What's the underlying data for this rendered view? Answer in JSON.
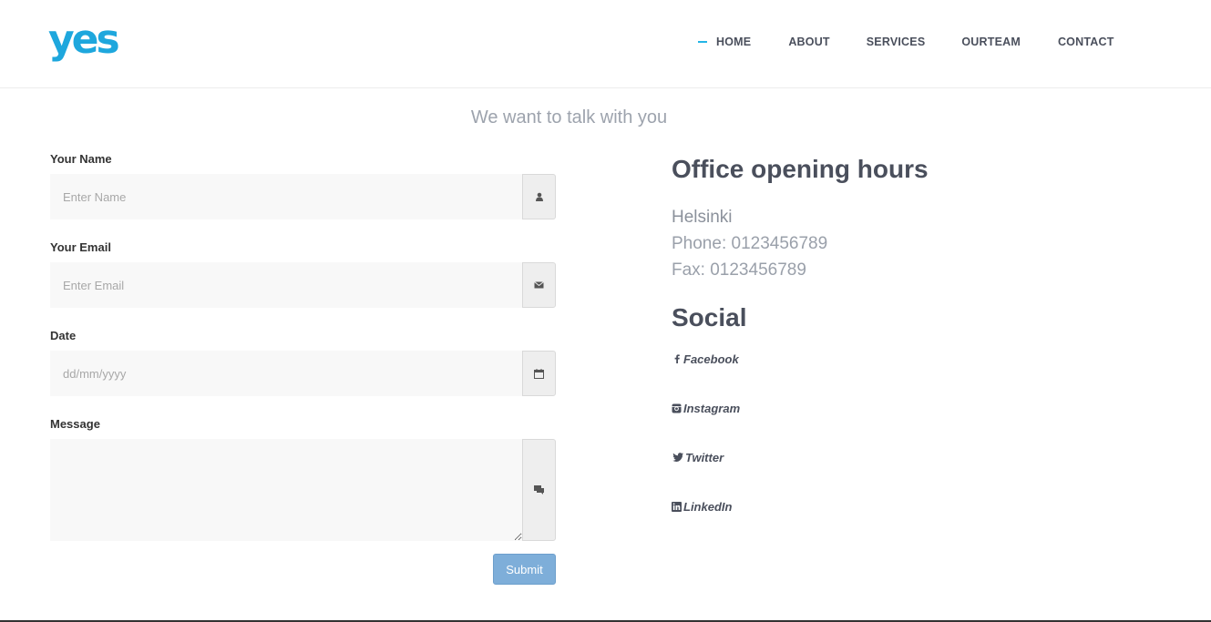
{
  "brand": {
    "logo_text": "yes",
    "logo_color": "#1ea7dd"
  },
  "nav": {
    "accent_color": "#23b5e6",
    "items": [
      {
        "label": "HOME",
        "active": true
      },
      {
        "label": "ABOUT"
      },
      {
        "label": "SERVICES"
      },
      {
        "label": "OURTEAM"
      },
      {
        "label": "CONTACT"
      }
    ]
  },
  "section": {
    "title": "We want to talk with you"
  },
  "form": {
    "name": {
      "label": "Your Name",
      "placeholder": "Enter Name",
      "icon": "user-icon"
    },
    "email": {
      "label": "Your Email",
      "placeholder": "Enter Email",
      "icon": "envelope-icon"
    },
    "date": {
      "label": "Date",
      "placeholder": "dd/mm/yyyy",
      "icon": "calendar-icon"
    },
    "message": {
      "label": "Message",
      "icon": "chat-icon"
    },
    "submit_label": "Submit",
    "submit_color": "#7eaed9"
  },
  "office": {
    "title": "Office opening hours",
    "city": "Helsinki",
    "phone": "Phone: 0123456789",
    "fax": "Fax: 0123456789"
  },
  "social": {
    "title": "Social",
    "items": [
      {
        "label": "Facebook",
        "icon": "facebook-icon"
      },
      {
        "label": "Instagram",
        "icon": "instagram-icon"
      },
      {
        "label": "Twitter",
        "icon": "twitter-icon"
      },
      {
        "label": "LinkedIn",
        "icon": "linkedin-icon"
      }
    ]
  }
}
